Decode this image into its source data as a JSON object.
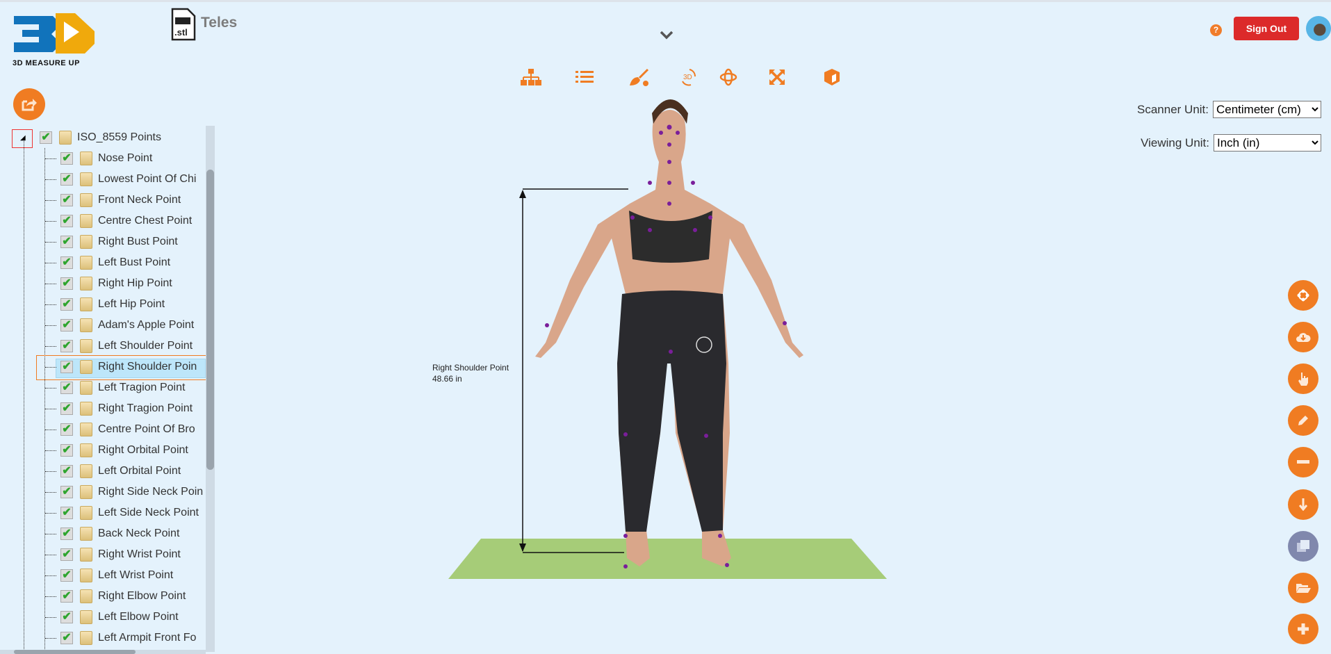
{
  "logo": {
    "text": "3D MEASURE UP"
  },
  "file": {
    "icon_label": ".stl",
    "title": "Teles"
  },
  "toolbar": {
    "icons": [
      "hierarchy-icon",
      "list-icon",
      "paint-broom-icon",
      "3d-rotate-icon",
      "orbit-icon",
      "expand-icon",
      "cube-icon"
    ]
  },
  "header": {
    "help": "?",
    "sign_out": "Sign Out"
  },
  "units": {
    "scanner_label": "Scanner Unit:",
    "scanner_value": "Centimeter (cm)",
    "viewing_label": "Viewing Unit:",
    "viewing_value": "Inch (in)"
  },
  "tree": {
    "root": "ISO_8559 Points",
    "selected_index": 10,
    "items": [
      "Nose Point",
      "Lowest Point Of Chi",
      "Front Neck Point",
      "Centre Chest Point",
      "Right Bust Point",
      "Left Bust Point",
      "Right Hip Point",
      "Left Hip Point",
      "Adam's Apple Point",
      "Left Shoulder Point",
      "Right Shoulder Poin",
      "Left Tragion Point",
      "Right Tragion Point",
      "Centre Point Of Bro",
      "Right Orbital Point",
      "Left Orbital Point",
      "Right Side Neck Poin",
      "Left Side Neck Point",
      "Back Neck Point",
      "Right Wrist Point",
      "Left Wrist Point",
      "Right Elbow Point",
      "Left Elbow Point",
      "Left Armpit Front Fo"
    ]
  },
  "measurement": {
    "name": "Right Shoulder Point",
    "value": "48.66 in"
  },
  "fabs": [
    "network-icon",
    "cloud-download-icon",
    "hand-pointer-icon",
    "pencil-icon",
    "minus-icon",
    "arrow-down-icon",
    "copy-icon",
    "folder-open-icon",
    "plus-icon"
  ],
  "colors": {
    "accent": "#f07c22",
    "sign_out": "#dc2a2a",
    "floor": "#a6cc78",
    "background": "#e4f2fc"
  }
}
